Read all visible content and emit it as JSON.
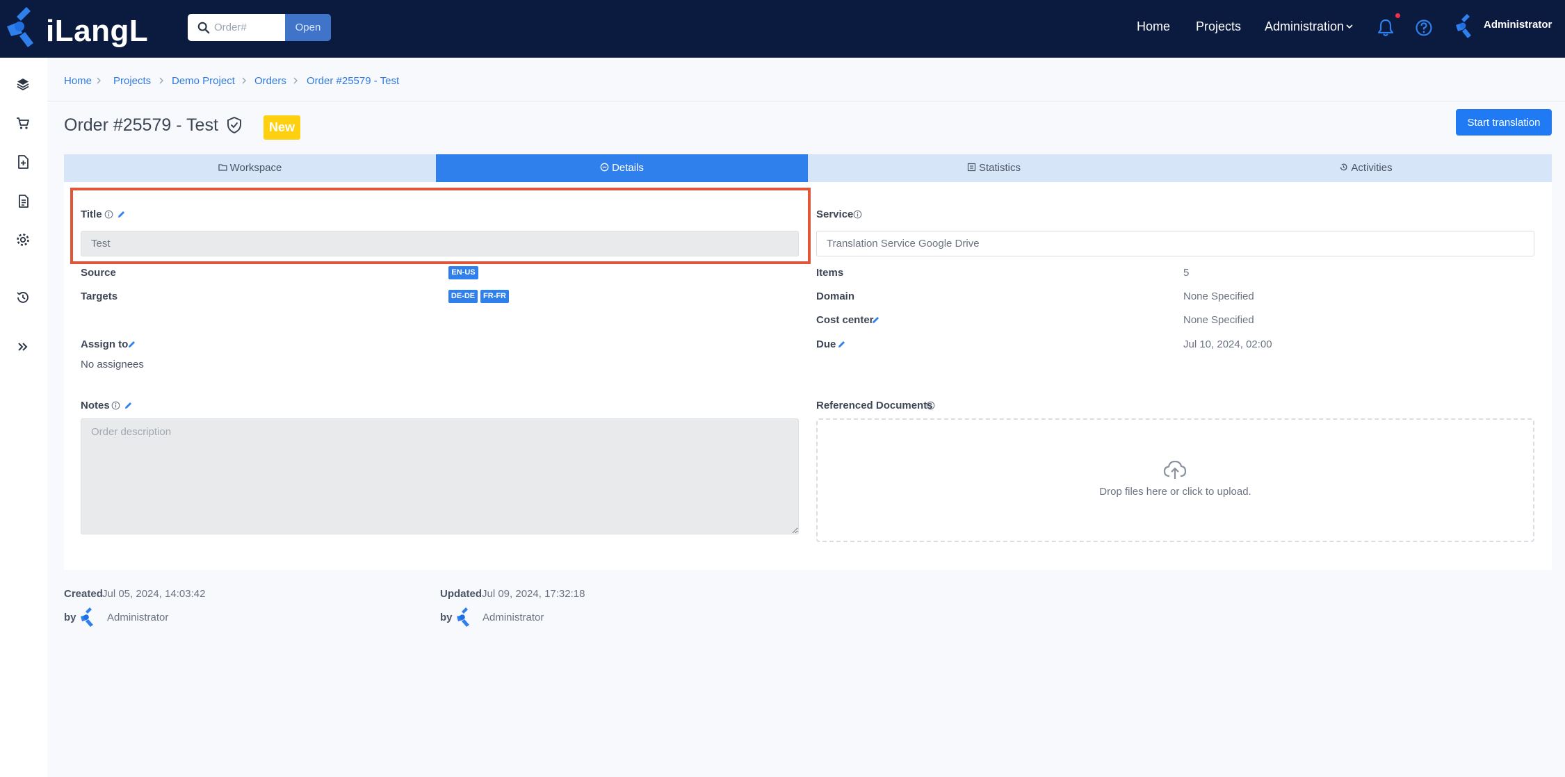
{
  "header": {
    "logo_text": "iLangL",
    "search_placeholder": "Order#",
    "open_label": "Open",
    "nav": {
      "home": "Home",
      "projects": "Projects",
      "administration": "Administration"
    },
    "user_name": "Administrator"
  },
  "breadcrumb": [
    "Home",
    "Projects",
    "Demo Project",
    "Orders",
    "Order #25579 - Test"
  ],
  "page": {
    "title": "Order #25579 - Test",
    "status": "New",
    "start_button": "Start translation"
  },
  "tabs": [
    {
      "label": "Workspace",
      "icon": "folder-icon"
    },
    {
      "label": "Details",
      "icon": "minus-circle-icon",
      "active": true
    },
    {
      "label": "Statistics",
      "icon": "statistics-icon"
    },
    {
      "label": "Activities",
      "icon": "history-icon"
    }
  ],
  "details": {
    "title_label": "Title",
    "title_value": "Test",
    "service_label": "Service",
    "service_value": "Translation Service Google Drive",
    "source_label": "Source",
    "source_lang": "EN-US",
    "targets_label": "Targets",
    "target_langs": [
      "DE-DE",
      "FR-FR"
    ],
    "items_label": "Items",
    "items_value": "5",
    "domain_label": "Domain",
    "domain_value": "None Specified",
    "cost_center_label": "Cost center",
    "cost_center_value": "None Specified",
    "assign_label": "Assign to",
    "assign_value": "No assignees",
    "due_label": "Due",
    "due_value": "Jul 10, 2024, 02:00",
    "notes_label": "Notes",
    "notes_placeholder": "Order description",
    "ref_docs_label": "Referenced Documents",
    "dropzone_text": "Drop files here or click to upload."
  },
  "meta": {
    "created_label": "Created",
    "created_value": "Jul 05, 2024, 14:03:42",
    "updated_label": "Updated",
    "updated_value": "Jul 09, 2024, 17:32:18",
    "by_label": "by",
    "created_by": "Administrator",
    "updated_by": "Administrator"
  },
  "colors": {
    "navbar": "#0b1a3f",
    "accent": "#2f80ed",
    "status_badge": "#ffd00f",
    "highlight": "#e0563a"
  }
}
